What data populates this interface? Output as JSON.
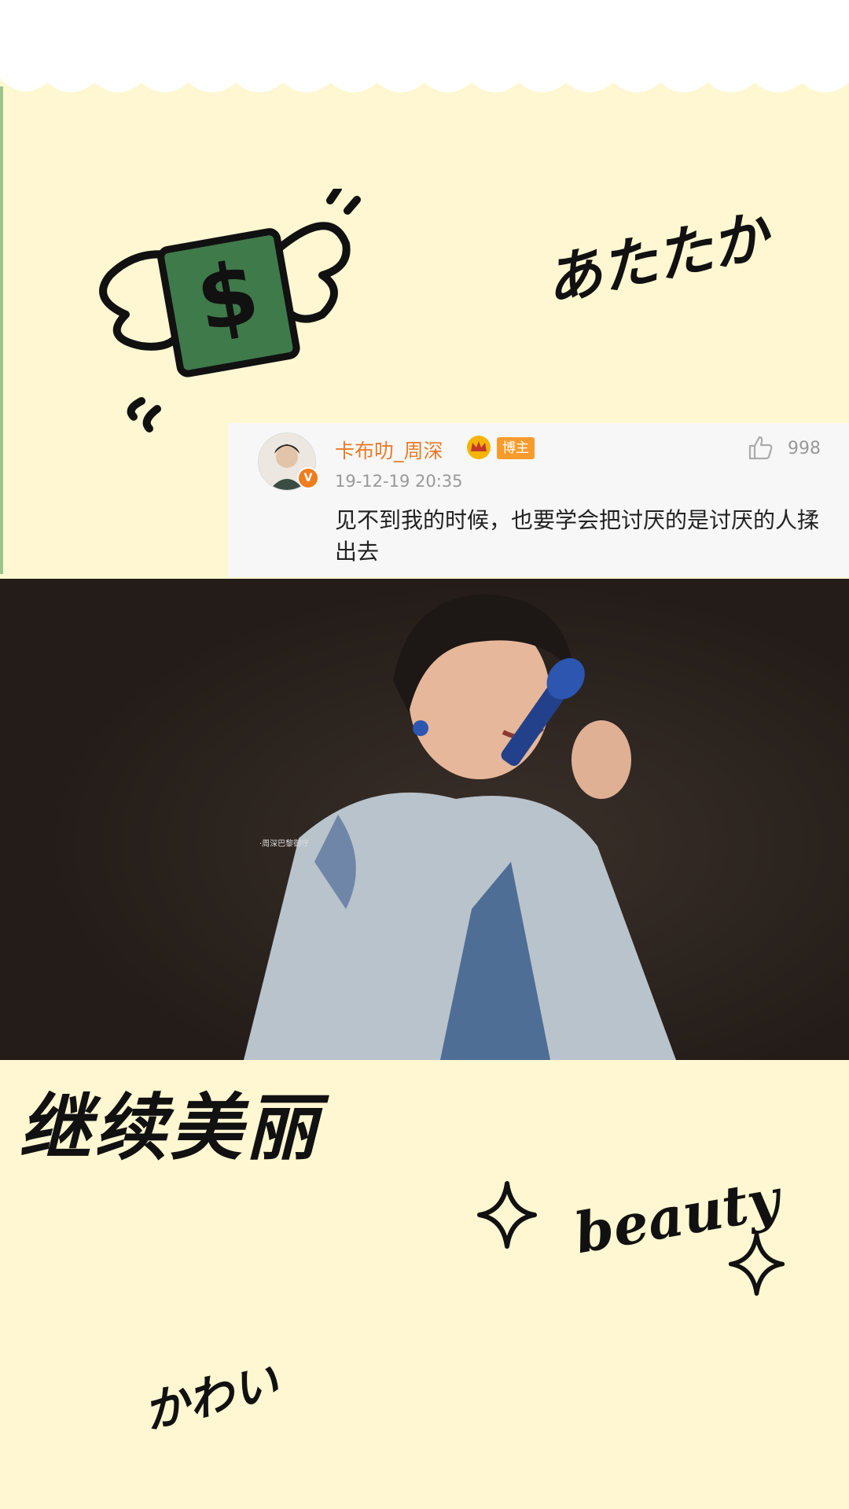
{
  "handwriting": {
    "atataka": "あたたか",
    "jixu": "继续美丽",
    "beauty": "beauty",
    "kawai": "かわい"
  },
  "comment": {
    "username": "卡布叻_周深",
    "host_badge": "博主",
    "timestamp": "19-12-19 20:35",
    "likes": "998",
    "text": "见不到我的时候，也要学会把讨厌的是讨厌的人揉出去",
    "verified_badge": "V"
  },
  "photo": {
    "watermark": "·周深巴黎御守"
  },
  "colors": {
    "background": "#fff7d1",
    "username": "#ea7b2a",
    "badge": "#f89b2d",
    "doodle_green": "#3f7a4a"
  },
  "icons": [
    "money-doodle-icon",
    "crown-icon",
    "like-icon",
    "sparkle-icon"
  ]
}
